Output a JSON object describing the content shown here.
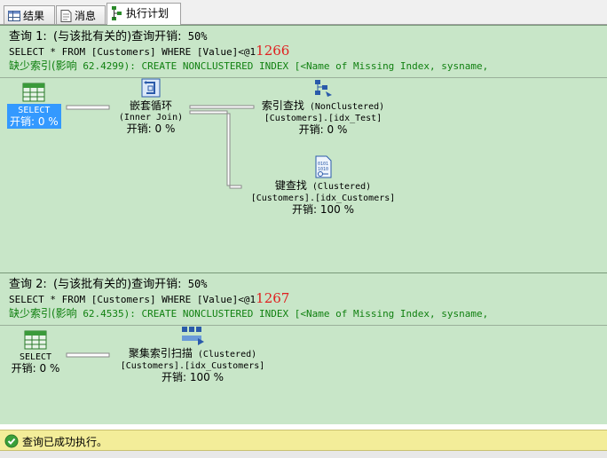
{
  "tabs": [
    {
      "label": "结果",
      "icon": "grid-icon"
    },
    {
      "label": "消息",
      "icon": "message-icon"
    },
    {
      "label": "执行计划",
      "icon": "plan-icon",
      "active": true
    }
  ],
  "queries": [
    {
      "title_prefix": "查询 1:",
      "title_rest": "(与该批有关的)查询开销:",
      "cost": "50%",
      "sql": "SELECT * FROM [Customers] WHERE [Value]<@1",
      "param_value": "1266",
      "missing_label": "缺少索引(影响",
      "missing_rest": "62.4299): CREATE NONCLUSTERED INDEX [<Name of Missing Index, sysname,",
      "operators": {
        "select": {
          "name": "SELECT",
          "cost": "开销: 0 %"
        },
        "nested_loops": {
          "name": "嵌套循环",
          "detail": "(Inner Join)",
          "cost": "开销: 0 %"
        },
        "index_seek": {
          "name": "索引查找",
          "type": "(NonClustered)",
          "object": "[Customers].[idx_Test]",
          "cost": "开销: 0 %"
        },
        "key_lookup": {
          "name": "键查找",
          "type": "(Clustered)",
          "object": "[Customers].[idx_Customers]",
          "cost": "开销: 100 %"
        }
      }
    },
    {
      "title_prefix": "查询 2:",
      "title_rest": "(与该批有关的)查询开销:",
      "cost": "50%",
      "sql": "SELECT * FROM [Customers] WHERE [Value]<@1",
      "param_value": "1267",
      "missing_label": "缺少索引(影响",
      "missing_rest": "62.4535): CREATE NONCLUSTERED INDEX [<Name of Missing Index, sysname,",
      "operators": {
        "select": {
          "name": "SELECT",
          "cost": "开销: 0 %"
        },
        "clustered_scan": {
          "name": "聚集索引扫描",
          "type": "(Clustered)",
          "object": "[Customers].[idx_Customers]",
          "cost": "开销: 100 %"
        }
      }
    }
  ],
  "status": {
    "text": "查询已成功执行。",
    "icon": "check-circle-icon"
  },
  "colors": {
    "panel_bg": "#c8e6c8",
    "missing_index": "#108010",
    "param": "#e02020",
    "selection": "#3399ff",
    "status_bg": "#f3ed99"
  }
}
